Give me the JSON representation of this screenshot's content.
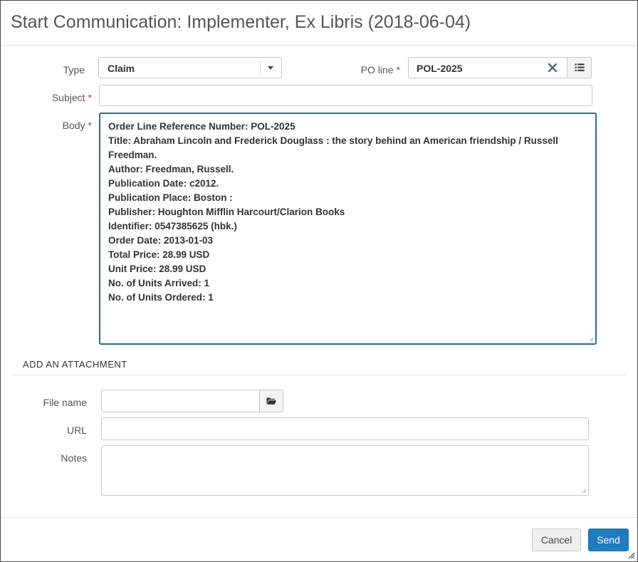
{
  "dialog": {
    "title": "Start Communication: Implementer, Ex Libris (2018-06-04)"
  },
  "form": {
    "type_label": "Type",
    "type_value": "Claim",
    "po_line_label": "PO line",
    "po_line_value": "POL-2025",
    "subject_label": "Subject",
    "subject_value": "",
    "body_label": "Body",
    "required_mark": "*",
    "body_lines": [
      "Order Line Reference Number: POL-2025",
      "Title: Abraham Lincoln and Frederick Douglass : the story behind an American friendship / Russell Freedman.",
      "Author: Freedman, Russell.",
      "Publication Date: c2012.",
      "Publication Place: Boston :",
      "Publisher: Houghton Mifflin Harcourt/Clarion Books",
      "Identifier: 0547385625 (hbk.)",
      "Order Date: 2013-01-03",
      "Total Price: 28.99 USD",
      "Unit Price: 28.99 USD",
      "No. of Units Arrived: 1",
      "No. of Units Ordered: 1"
    ]
  },
  "attachment": {
    "section_title": "ADD AN ATTACHMENT",
    "file_name_label": "File name",
    "file_name_value": "",
    "url_label": "URL",
    "url_value": "",
    "notes_label": "Notes",
    "notes_value": ""
  },
  "footer": {
    "cancel_label": "Cancel",
    "send_label": "Send"
  },
  "icons": {
    "type_dropdown": "chevron-down-icon",
    "po_clear": "close-icon",
    "po_list": "list-icon",
    "file_browse": "folder-icon"
  },
  "colors": {
    "primary": "#1f7bbf",
    "focus_border": "#26708a",
    "required": "#c9302c"
  }
}
